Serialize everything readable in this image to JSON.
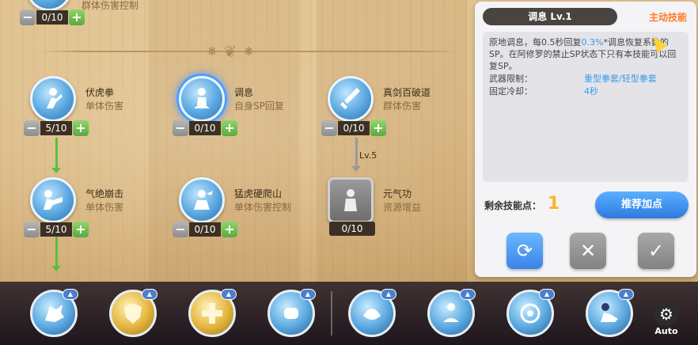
{
  "tree": {
    "top_partial": {
      "type": "群体伤害控制",
      "level": "0/10"
    },
    "skills": [
      {
        "id": "fuhuquan",
        "name": "伏虎拳",
        "type": "单体伤害",
        "level": "5/10"
      },
      {
        "id": "tiaoxi",
        "name": "调息",
        "type": "自身SP回复",
        "level": "0/10"
      },
      {
        "id": "zhenjian",
        "name": "真剑百破道",
        "type": "群体伤害",
        "level": "0/10"
      },
      {
        "id": "qijue",
        "name": "气绝崩击",
        "type": "单体伤害",
        "level": "5/10"
      },
      {
        "id": "menghu",
        "name": "猛虎硬爬山",
        "type": "单体伤害控制",
        "level": "0/10"
      },
      {
        "id": "yuanqi",
        "name": "元气功",
        "type": "资源增益",
        "level": "0/10"
      }
    ],
    "requirement_label": "Lv.5"
  },
  "detail": {
    "title": "调息 Lv.1",
    "kind": "主动技能",
    "desc_a": "原地调息，每0.5秒回复",
    "desc_hl": "0.3%",
    "desc_b": "*调息恢复系数的SP。在阿修罗的禁止SP状态下只有本技能可以回复SP。",
    "weapon_key": "武器限制：",
    "weapon_val": "重型拳套/轻型拳套",
    "cooldown_key": "固定冷却：",
    "cooldown_val": "4秒",
    "points_label": "剩余技能点：",
    "points_value": "1",
    "recommend_label": "推荐加点"
  },
  "hotbar": {
    "auto_label": "Auto"
  },
  "colors": {
    "accent_blue": "#3a9be8",
    "accent_orange": "#ff7a2a",
    "level_plus": "#5ca93f",
    "points_gold": "#ffb22a"
  }
}
